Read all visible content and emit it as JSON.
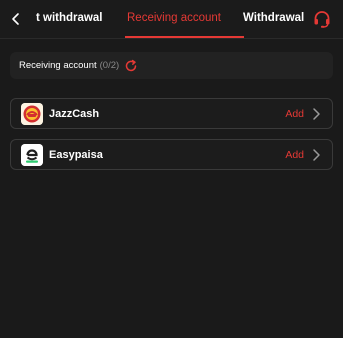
{
  "header": {
    "tabs": [
      {
        "label": "t withdrawal",
        "active": false
      },
      {
        "label": "Receiving account",
        "active": true
      },
      {
        "label": "Withdrawal l",
        "active": false
      }
    ],
    "back_icon": "chevron-left-icon",
    "support_icon": "headset-icon"
  },
  "summary": {
    "label": "Receiving account",
    "count": "(0/2)",
    "refresh_icon": "refresh-icon"
  },
  "accounts": [
    {
      "name": "JazzCash",
      "action": "Add",
      "logo_icon": "jazzcash-logo"
    },
    {
      "name": "Easypaisa",
      "action": "Add",
      "logo_icon": "easypaisa-logo"
    }
  ],
  "colors": {
    "accent": "#e53935",
    "background": "#1a1a1a",
    "row_border": "#3a3a3a",
    "muted_text": "#8a8a8a"
  }
}
